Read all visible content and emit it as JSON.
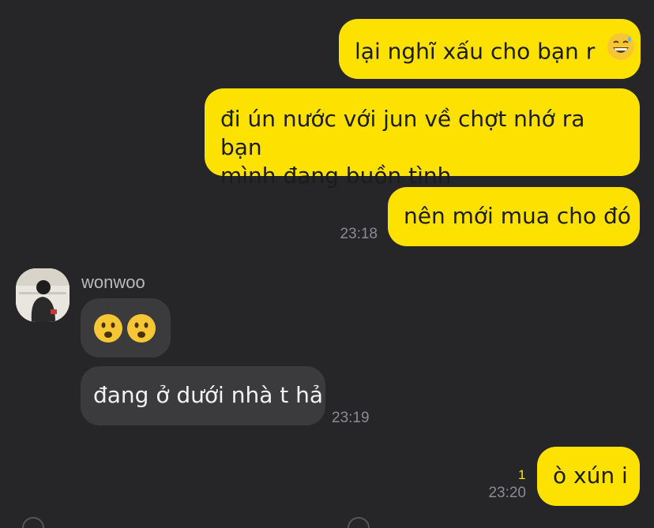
{
  "messages_out": [
    {
      "text": "lại nghĩ xấu cho bạn r",
      "emoji": "grinning-sweat-emoji"
    },
    {
      "line1": "đi ún nước với jun về chợt nhớ ra bạn",
      "line2": "mình đang buồn tình"
    },
    {
      "text": "nên mới mua cho đó",
      "time": "23:18"
    }
  ],
  "incoming": {
    "sender": "wonwoo",
    "emoji_message": [
      "frowning-face-emoji",
      "frowning-face-emoji"
    ],
    "text": "đang ở dưới nhà t hả",
    "time": "23:19"
  },
  "last_out": {
    "text": "ò xún i",
    "unread_count": "1",
    "time": "23:20"
  },
  "colors": {
    "background": "#262628",
    "outgoing_bubble": "#FDE101",
    "incoming_bubble": "#3B3B3E",
    "timestamp": "#8c8c90",
    "unread": "#FDE101"
  }
}
